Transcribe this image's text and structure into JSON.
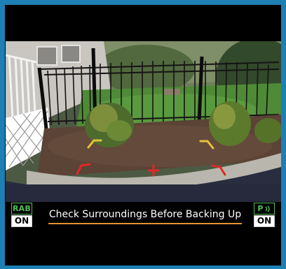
{
  "rear_camera": {
    "left_badge": {
      "label": "RAB",
      "value": "ON"
    },
    "right_badge": {
      "label": "P",
      "value": "ON",
      "icon": "parking-sonar-icon"
    },
    "notice": "Check Surroundings Before Backing Up",
    "colors": {
      "frame": "#1d7fb4",
      "badge_label": "#4fbf5a",
      "underline": "#e8932b",
      "guide_far": "#e6c23a",
      "guide_near": "#e02828"
    }
  }
}
